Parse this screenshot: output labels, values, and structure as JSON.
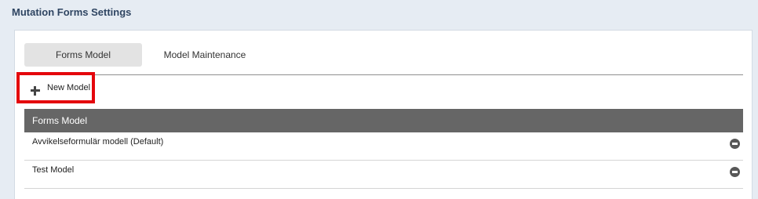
{
  "page": {
    "title": "Mutation Forms Settings"
  },
  "tabs": [
    {
      "label": "Forms Model",
      "active": true
    },
    {
      "label": "Model Maintenance",
      "active": false
    }
  ],
  "toolbar": {
    "new_model_label": "New Model",
    "new_model_icon": "plus-icon"
  },
  "table": {
    "header": "Forms Model",
    "rows": [
      {
        "label": "Avvikelseformulär modell (Default)",
        "action_icon": "remove-icon"
      },
      {
        "label": "Test Model",
        "action_icon": "remove-icon"
      }
    ]
  },
  "colors": {
    "background": "#e6ecf3",
    "title_text": "#2f4562",
    "active_tab": "#e3e3e3",
    "table_header": "#666666",
    "highlight": "#e4060c"
  }
}
